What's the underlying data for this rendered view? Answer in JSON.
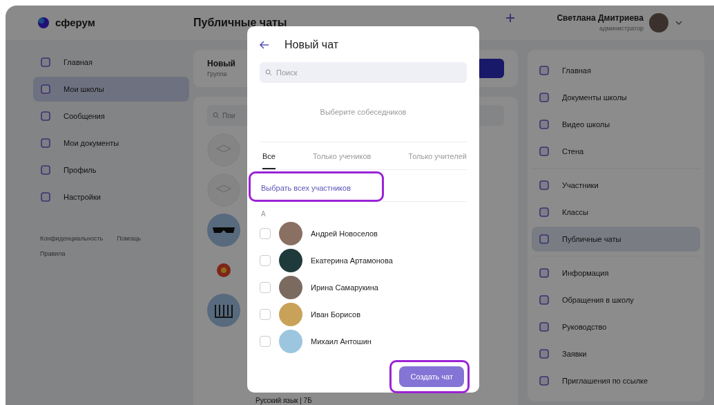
{
  "app": {
    "logo": "сферум",
    "page_title": "Публичные чаты",
    "user": {
      "name": "Светлана Дмитриева",
      "role": "администратор"
    }
  },
  "left_nav": [
    {
      "label": "Главная",
      "selected": false
    },
    {
      "label": "Мои школы",
      "selected": true
    },
    {
      "label": "Сообщения",
      "selected": false
    },
    {
      "label": "Мои документы",
      "selected": false
    },
    {
      "label": "Профиль",
      "selected": false
    },
    {
      "label": "Настройки",
      "selected": false
    }
  ],
  "footer_links": [
    "Конфиденциальность",
    "Помощь",
    "Правила"
  ],
  "background_content": {
    "card_title": "Новый",
    "card_subtitle": "Группа",
    "search_placeholder": "Пои",
    "chat_rows": [
      {
        "kind": "placeholder"
      },
      {
        "kind": "placeholder"
      },
      {
        "kind": "glasses"
      },
      {
        "kind": "flower"
      },
      {
        "kind": "book"
      }
    ],
    "bottom_text": "Русский язык | 7Б"
  },
  "right_nav": [
    [
      {
        "label": "Главная",
        "selected": false
      },
      {
        "label": "Документы школы",
        "selected": false
      },
      {
        "label": "Видео школы",
        "selected": false
      },
      {
        "label": "Стена",
        "selected": false
      }
    ],
    [
      {
        "label": "Участники",
        "selected": false
      },
      {
        "label": "Классы",
        "selected": false
      },
      {
        "label": "Публичные чаты",
        "selected": true
      }
    ],
    [
      {
        "label": "Информация",
        "selected": false
      },
      {
        "label": "Обращения в школу",
        "selected": false
      },
      {
        "label": "Руководство",
        "selected": false
      },
      {
        "label": "Заявки",
        "selected": false
      },
      {
        "label": "Приглашения по ссылке",
        "selected": false
      }
    ]
  ],
  "modal": {
    "title": "Новый чат",
    "search_placeholder": "Поиск",
    "empty_hint": "Выберите собеседников",
    "tabs": [
      {
        "label": "Все",
        "selected": true
      },
      {
        "label": "Только учеников",
        "selected": false
      },
      {
        "label": "Только учителей",
        "selected": false
      }
    ],
    "select_all": "Выбрать всех участников",
    "letter": "А",
    "members": [
      {
        "name": "Андрей Новоселов",
        "checked": false
      },
      {
        "name": "Екатерина Артамонова",
        "checked": false
      },
      {
        "name": "Ирина Самарукина",
        "checked": false
      },
      {
        "name": "Иван Борисов",
        "checked": false
      },
      {
        "name": "Михаил Антошин",
        "checked": false
      }
    ],
    "create_button": "Создать чат"
  }
}
